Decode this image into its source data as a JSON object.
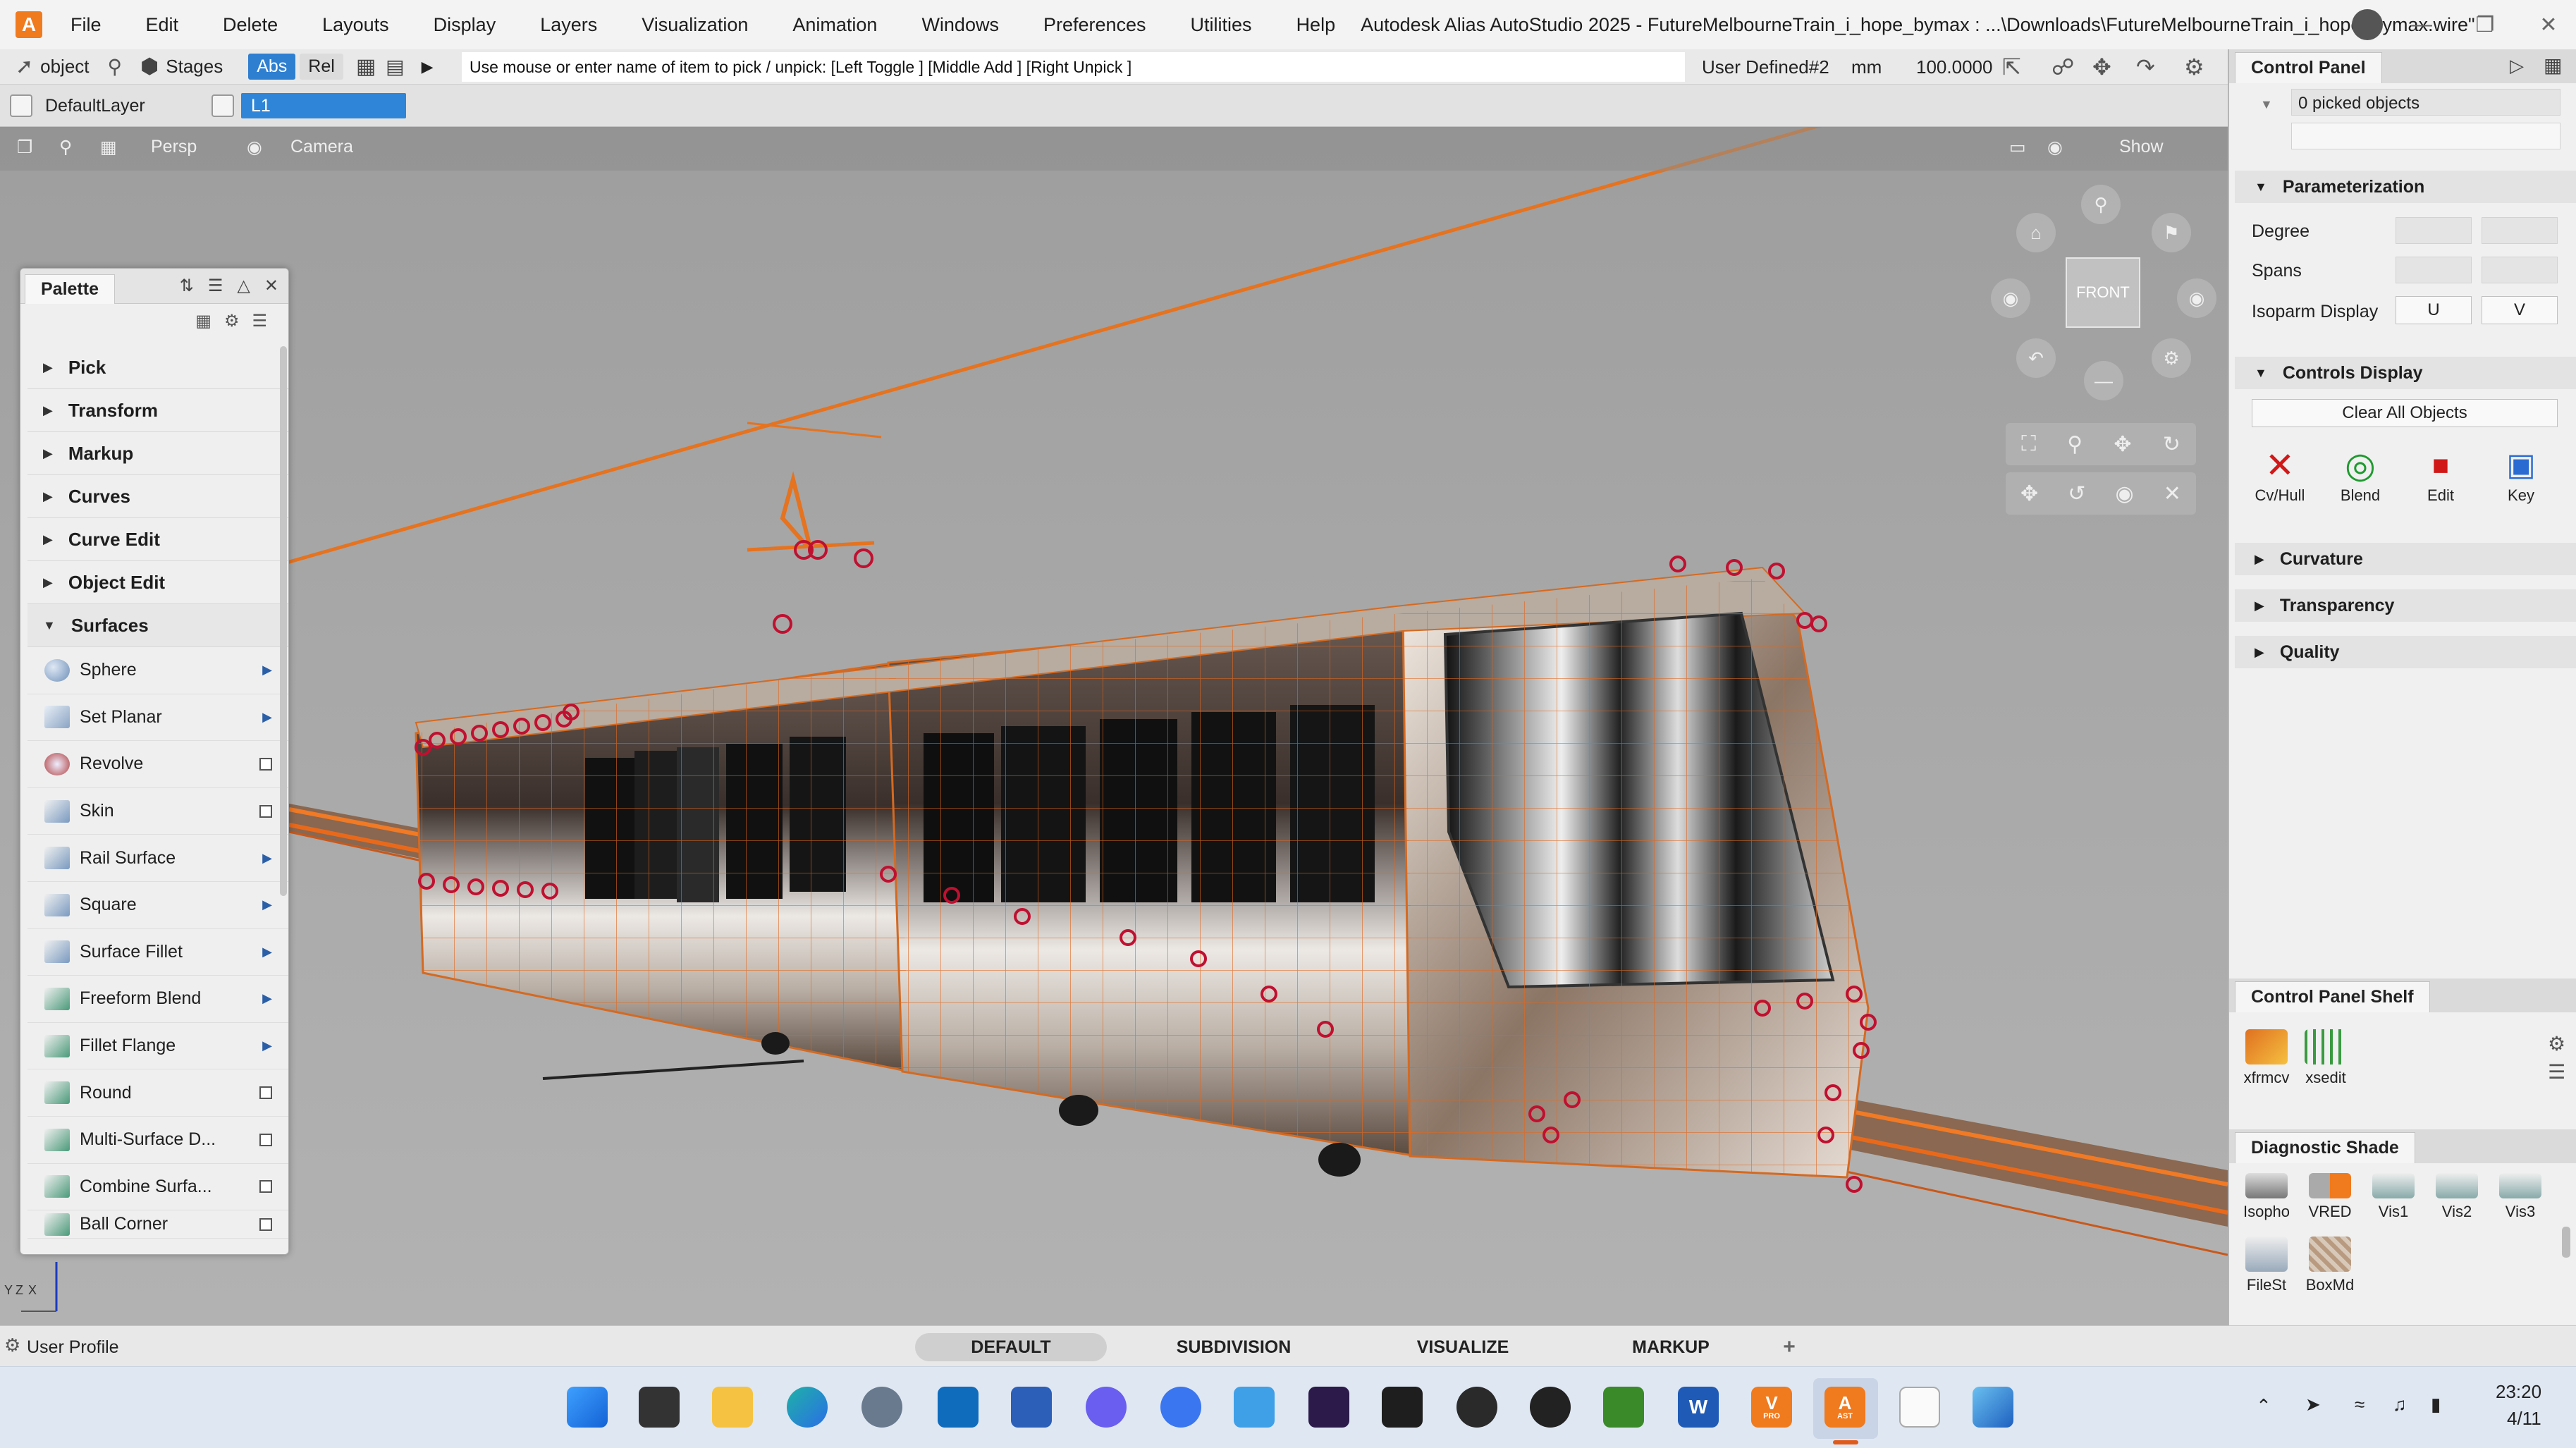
{
  "menubar": {
    "logo": "A",
    "items": [
      "File",
      "Edit",
      "Delete",
      "Layouts",
      "Display",
      "Layers",
      "Visualization",
      "Animation",
      "Windows",
      "Preferences",
      "Utilities",
      "Help"
    ],
    "title": "Autodesk Alias AutoStudio 2025    - FutureMelbourneTrain_i_hope_bymax : ...\\Downloads\\FutureMelbourneTrain_i_hope_bymax.wire\""
  },
  "toolbar": {
    "pick_label": "object",
    "stages_label": "Stages",
    "abs_label": "Abs",
    "rel_label": "Rel",
    "prompt": "Use mouse or enter name of item to pick / unpick: [Left Toggle ] [Middle Add ] [Right Unpick ]",
    "construction": "User Defined#2",
    "units": "mm",
    "scale": "100.0000"
  },
  "layers": {
    "default_layer": "DefaultLayer",
    "active_layer": "L1"
  },
  "viewbar": {
    "persp": "Persp",
    "camera": "Camera",
    "show": "Show"
  },
  "viewcube": {
    "label": "FRONT"
  },
  "palette": {
    "title": "Palette",
    "categories": [
      "Pick",
      "Transform",
      "Markup",
      "Curves",
      "Curve Edit",
      "Object Edit",
      "Surfaces"
    ],
    "surfaces": [
      {
        "label": "Sphere",
        "kind": "arrow"
      },
      {
        "label": "Set Planar",
        "kind": "arrow"
      },
      {
        "label": "Revolve",
        "kind": "option"
      },
      {
        "label": "Skin",
        "kind": "option"
      },
      {
        "label": "Rail Surface",
        "kind": "arrow"
      },
      {
        "label": "Square",
        "kind": "arrow"
      },
      {
        "label": "Surface Fillet",
        "kind": "arrow"
      },
      {
        "label": "Freeform Blend",
        "kind": "arrow"
      },
      {
        "label": "Fillet Flange",
        "kind": "arrow"
      },
      {
        "label": "Round",
        "kind": "option"
      },
      {
        "label": "Multi-Surface D...",
        "kind": "option"
      },
      {
        "label": "Combine Surfa...",
        "kind": "option"
      },
      {
        "label": "Ball Corner",
        "kind": "option"
      }
    ]
  },
  "control_panel": {
    "title": "Control Panel",
    "picked": "0 picked objects",
    "parameterization": "Parameterization",
    "degree": "Degree",
    "spans": "Spans",
    "isoparm": "Isoparm Display",
    "u": "U",
    "v": "V",
    "controls_display": "Controls Display",
    "clear_all": "Clear All Objects",
    "cd_items": [
      "Cv/Hull",
      "Blend",
      "Edit",
      "Key"
    ],
    "curvature": "Curvature",
    "transparency": "Transparency",
    "quality": "Quality"
  },
  "shelf": {
    "title": "Control Panel Shelf",
    "items": [
      "xfrmcv",
      "xsedit"
    ]
  },
  "diagnostic": {
    "title": "Diagnostic Shade",
    "items": [
      "Isopho",
      "VRED",
      "Vis1",
      "Vis2",
      "Vis3",
      "FileSt",
      "BoxMd"
    ]
  },
  "status": {
    "user_profile": "User Profile"
  },
  "workspaces": [
    "DEFAULT",
    "SUBDIVISION",
    "VISUALIZE",
    "MARKUP"
  ],
  "axes": {
    "y": "Y",
    "z": "Z",
    "x": "X"
  },
  "taskbar": {
    "time": "23:20",
    "date": "4/11",
    "word_letter": "W",
    "vred_letter": "V",
    "vred_sub": "PRO",
    "alias_letter": "A",
    "alias_sub": "AST"
  }
}
